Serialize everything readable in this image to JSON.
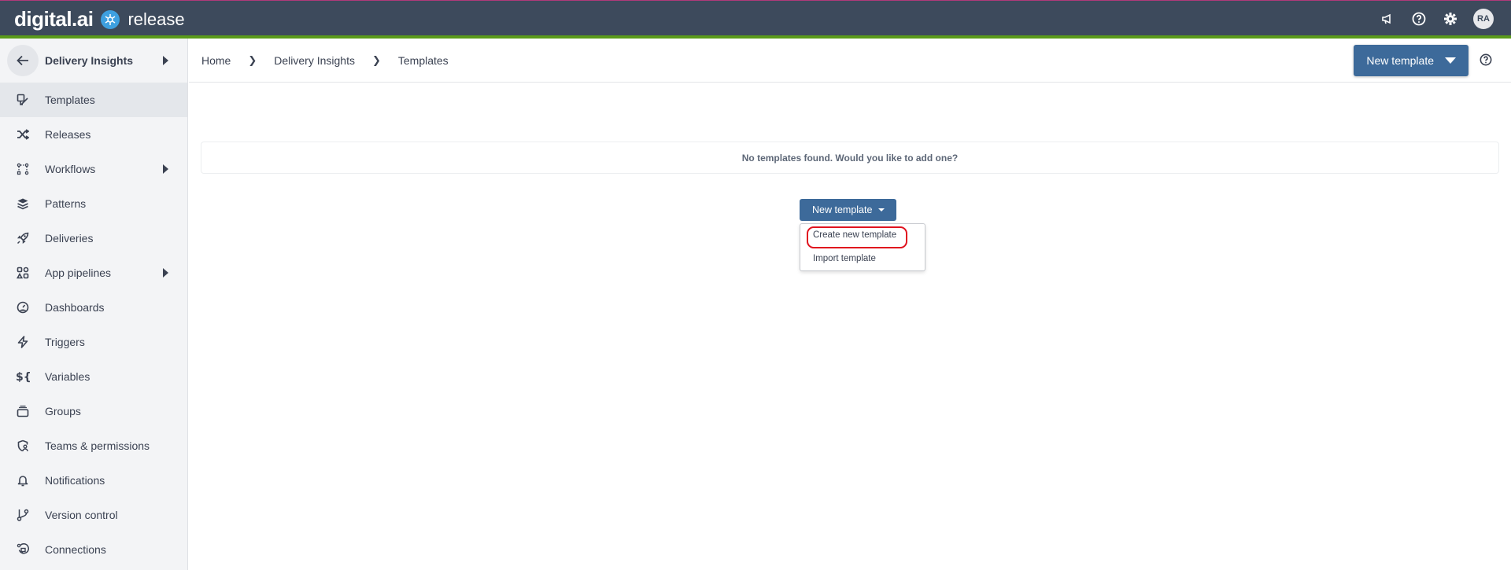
{
  "topbar": {
    "brand": "digital.ai",
    "product": "release",
    "icons": [
      "megaphone-icon",
      "help-icon",
      "gear-icon"
    ],
    "avatar_initials": "RA",
    "colors": {
      "bar": "#3d4a5c",
      "accent_line": "#5a9a1a",
      "release_mark": "#3ea0e0"
    }
  },
  "sidebar": {
    "header": {
      "label": "Delivery Insights",
      "back_icon": "arrow-left-icon"
    },
    "items": [
      {
        "label": "Templates",
        "icon": "template-icon",
        "active": true,
        "submenu": false
      },
      {
        "label": "Releases",
        "icon": "shuffle-icon",
        "active": false,
        "submenu": false
      },
      {
        "label": "Workflows",
        "icon": "workflow-icon",
        "active": false,
        "submenu": true
      },
      {
        "label": "Patterns",
        "icon": "layers-icon",
        "active": false,
        "submenu": false
      },
      {
        "label": "Deliveries",
        "icon": "rocket-icon",
        "active": false,
        "submenu": false
      },
      {
        "label": "App pipelines",
        "icon": "shapes-icon",
        "active": false,
        "submenu": true
      },
      {
        "label": "Dashboards",
        "icon": "gauge-icon",
        "active": false,
        "submenu": false
      },
      {
        "label": "Triggers",
        "icon": "lightning-icon",
        "active": false,
        "submenu": false
      },
      {
        "label": "Variables",
        "icon": "variable-icon",
        "active": false,
        "submenu": false
      },
      {
        "label": "Groups",
        "icon": "stack-icon",
        "active": false,
        "submenu": false
      },
      {
        "label": "Teams & permissions",
        "icon": "shield-user-icon",
        "active": false,
        "submenu": false
      },
      {
        "label": "Notifications",
        "icon": "bell-icon",
        "active": false,
        "submenu": false
      },
      {
        "label": "Version control",
        "icon": "branch-icon",
        "active": false,
        "submenu": false
      },
      {
        "label": "Connections",
        "icon": "plug-icon",
        "active": false,
        "submenu": false
      }
    ]
  },
  "header": {
    "breadcrumbs": [
      "Home",
      "Delivery Insights",
      "Templates"
    ],
    "new_template_label": "New template"
  },
  "main": {
    "empty_message": "No templates found. Would you like to add one?",
    "new_template_label": "New template",
    "dropdown_items": [
      "Create new template",
      "Import template"
    ],
    "highlighted_item": "Create new template",
    "colors": {
      "primary_button": "#3d6a9a",
      "highlight_ring": "#e0121e"
    }
  }
}
